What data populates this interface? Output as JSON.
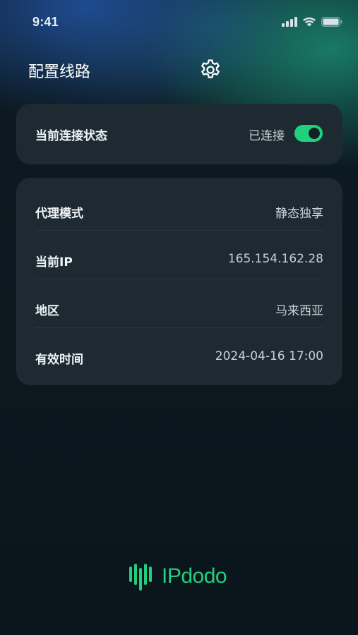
{
  "status_bar": {
    "time": "9:41"
  },
  "header": {
    "title": "配置线路"
  },
  "connection": {
    "label": "当前连接状态",
    "status_text": "已连接",
    "enabled": true
  },
  "info": {
    "rows": [
      {
        "label": "代理模式",
        "value": "静态独享"
      },
      {
        "label": "当前IP",
        "value": "165.154.162.28"
      },
      {
        "label": "地区",
        "value": "马来西亚"
      },
      {
        "label": "有效时间",
        "value": "2024-04-16 17:00"
      }
    ]
  },
  "brand": {
    "name": "IPdodo",
    "accent": "#1fd07e"
  },
  "colors": {
    "card": "#1d2a31",
    "background": "#0b171d",
    "toggle_on": "#1fd07e"
  }
}
